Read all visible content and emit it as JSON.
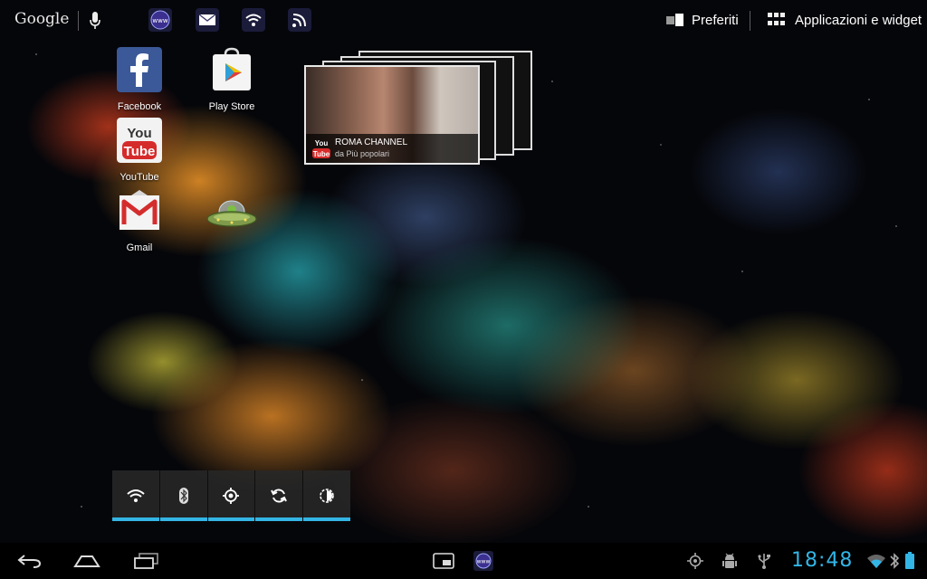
{
  "topbar": {
    "search_label": "Google",
    "favorites_label": "Preferiti",
    "apps_label": "Applicazioni e widget",
    "shortcuts": [
      "browser-icon",
      "email-icon",
      "wifi-icon",
      "rss-icon"
    ]
  },
  "home": {
    "apps": [
      {
        "label": "Facebook",
        "icon": "facebook-icon"
      },
      {
        "label": "Play Store",
        "icon": "play-store-icon"
      },
      {
        "label": "YouTube",
        "icon": "youtube-icon"
      },
      {
        "label": "Gmail",
        "icon": "gmail-icon"
      }
    ],
    "ufo_icon": "ufo-icon"
  },
  "youtube_widget": {
    "title": "ROMA CHANNEL",
    "subtitle": "da Più popolari",
    "logo_top": "You",
    "logo_bottom": "Tube"
  },
  "power_widget": {
    "toggles": [
      "wifi",
      "bluetooth",
      "gps",
      "sync",
      "brightness"
    ],
    "accent": "#33b5e5"
  },
  "systembar": {
    "clock": "18:48",
    "accent": "#33b5e5",
    "nav": [
      "back-icon",
      "home-icon",
      "recents-icon"
    ],
    "center": [
      "screen-icon",
      "browser-icon"
    ],
    "notifications": [
      "gps-icon",
      "android-debug-icon",
      "usb-icon"
    ],
    "status": [
      "wifi-signal-icon",
      "bluetooth-icon",
      "battery-icon"
    ]
  }
}
